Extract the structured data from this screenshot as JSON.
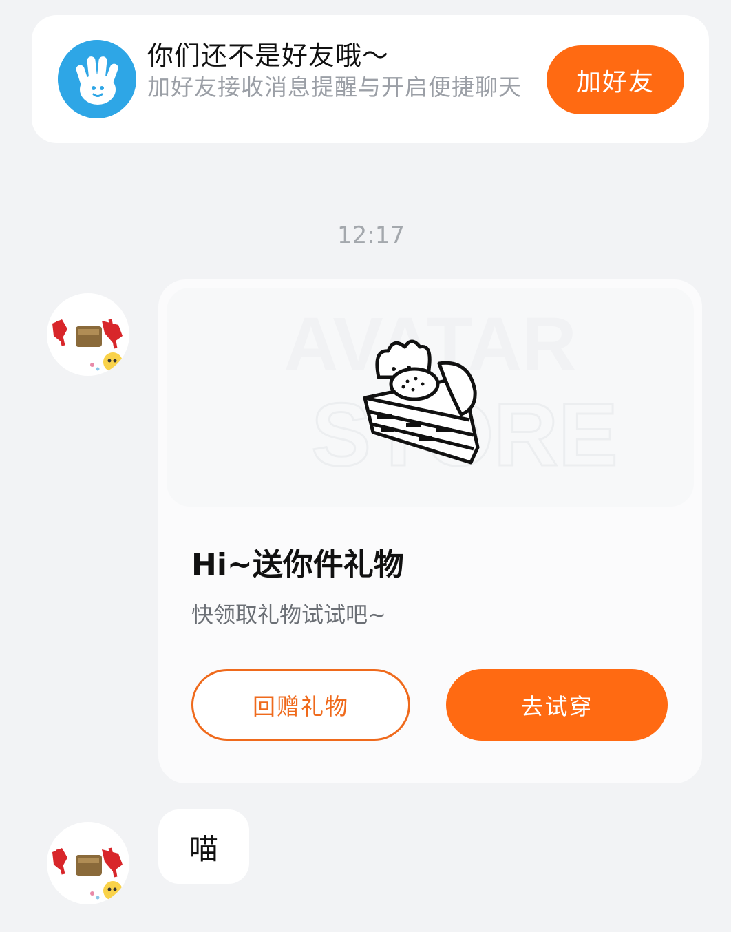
{
  "friend_banner": {
    "title": "你们还不是好友哦～",
    "subtitle": "加好友接收消息提醒与开启便捷聊天",
    "add_button": "加好友",
    "icon": "waving-hand-icon"
  },
  "timestamp": "12:17",
  "messages": [
    {
      "type": "gift_card",
      "sender_avatar": "school-emblem-avatar",
      "watermark_line1": "AVATAR",
      "watermark_line2": "STORE",
      "image_icon": "bunny-cake-icon",
      "title": "Hi~送你件礼物",
      "description": "快领取礼物试试吧~",
      "return_button": "回赠礼物",
      "try_button": "去试穿"
    },
    {
      "type": "text",
      "sender_avatar": "school-emblem-avatar",
      "text": "喵"
    }
  ],
  "colors": {
    "accent": "#ff6a12",
    "background": "#f2f3f5",
    "card": "#ffffff",
    "friend_icon": "#2ea6e6"
  }
}
